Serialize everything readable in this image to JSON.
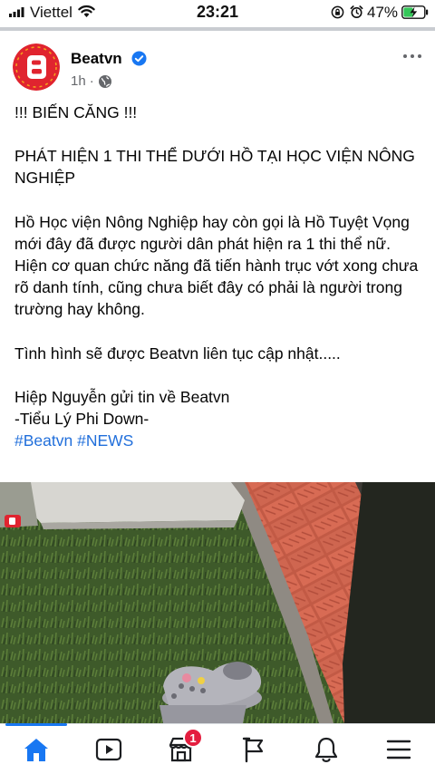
{
  "status_bar": {
    "carrier": "Viettel",
    "time": "23:21",
    "battery_percent": "47%",
    "battery_level": 0.47
  },
  "post": {
    "author": "Beatvn",
    "age": "1h",
    "headline": "!!! BIẾN CĂNG !!!",
    "title": "PHÁT HIỆN 1 THI THỂ DƯỚI HỒ TẠI HỌC VIỆN NÔNG NGHIỆP",
    "body": "Hồ Học viện Nông Nghiệp hay còn gọi là Hồ Tuyệt Vọng mới đây đã được người dân phát hiện ra 1 thi thể nữ. Hiện cơ quan chức năng đã tiến hành trục vớt xong chưa rõ danh tính, cũng chưa biết đây có phải là người trong trường hay không.",
    "update": "Tình hình sẽ được Beatvn liên tục cập nhật.....",
    "credit_line1": "Hiệp Nguyễn gửi tin về Beatvn",
    "credit_line2": "-Tiểu Lý Phi Down-",
    "hashtags": [
      "#Beatvn",
      "#NEWS"
    ]
  },
  "nav": {
    "items": [
      "home-icon",
      "video-icon",
      "marketplace-icon",
      "pages-flag-icon",
      "notifications-bell-icon",
      "menu-icon"
    ],
    "marketplace_badge": "1",
    "active": "home",
    "accent_color": "#1877f2"
  },
  "colors": {
    "hashtag": "#216fdb",
    "badge": "#e41e3f",
    "brand_avatar": "#e0242f"
  }
}
